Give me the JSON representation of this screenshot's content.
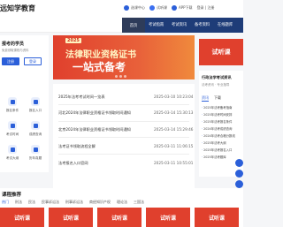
{
  "header": {
    "logo": "远知学教育",
    "links": [
      "选课中心",
      "试听课",
      "APP下载"
    ],
    "auth": "登录 | 注册"
  },
  "nav": {
    "items": [
      "首页",
      "考试指南",
      "考试资讯",
      "备考资料",
      "在线题库"
    ]
  },
  "left_panel": {
    "title": "报考的学员",
    "subtitle": "免费领取课程与资料",
    "btn_primary": "注册",
    "btn_secondary": "登录",
    "tiles": [
      "报名条件",
      "报名入口",
      "考试时间",
      "成绩查询",
      "考试大纲",
      "历年真题"
    ]
  },
  "banner": {
    "badge": "2025",
    "line1": "法律职业资格证书",
    "line2": "一站式备考"
  },
  "news": [
    {
      "title": "2025年法考考试时间一览表",
      "date": "2025-03-10 10:23:04"
    },
    {
      "title": "河北2024年法律职业资格证书领取时间通知",
      "date": "2025-03-14 15:30:13"
    },
    {
      "title": "北京2024年法律职业资格证书领取时间通知",
      "date": "2025-03-14 15:29:46"
    },
    {
      "title": "法考证书领取流程全解",
      "date": "2025-03-11 11:06:15"
    },
    {
      "title": "法考报名入口官网",
      "date": "2025-03-11 10:55:01"
    }
  ],
  "right_panel": {
    "banner": "试听课",
    "title": "行政法学考试资讯",
    "subtitle": "法考资讯 · 专业指导",
    "tabs": [
      "资讯",
      "下载"
    ],
    "rows": [
      "2025年法考备考指南",
      "2025年法考时间安排",
      "2025年法考报名条件",
      "2024年法考成绩查询",
      "2024年法考合格分数线",
      "2025年法考大纲",
      "2025年法考报名入口",
      "2025年法考题库"
    ]
  },
  "bottom": {
    "title": "课程推荐",
    "tabs": [
      "热门",
      "刑法",
      "民法",
      "民事诉讼法",
      "刑事诉讼法",
      "商经知识产权",
      "理论法",
      "三国法"
    ],
    "cards": [
      "试听课",
      "试听课",
      "试听课",
      "试听课",
      "试听课"
    ]
  }
}
